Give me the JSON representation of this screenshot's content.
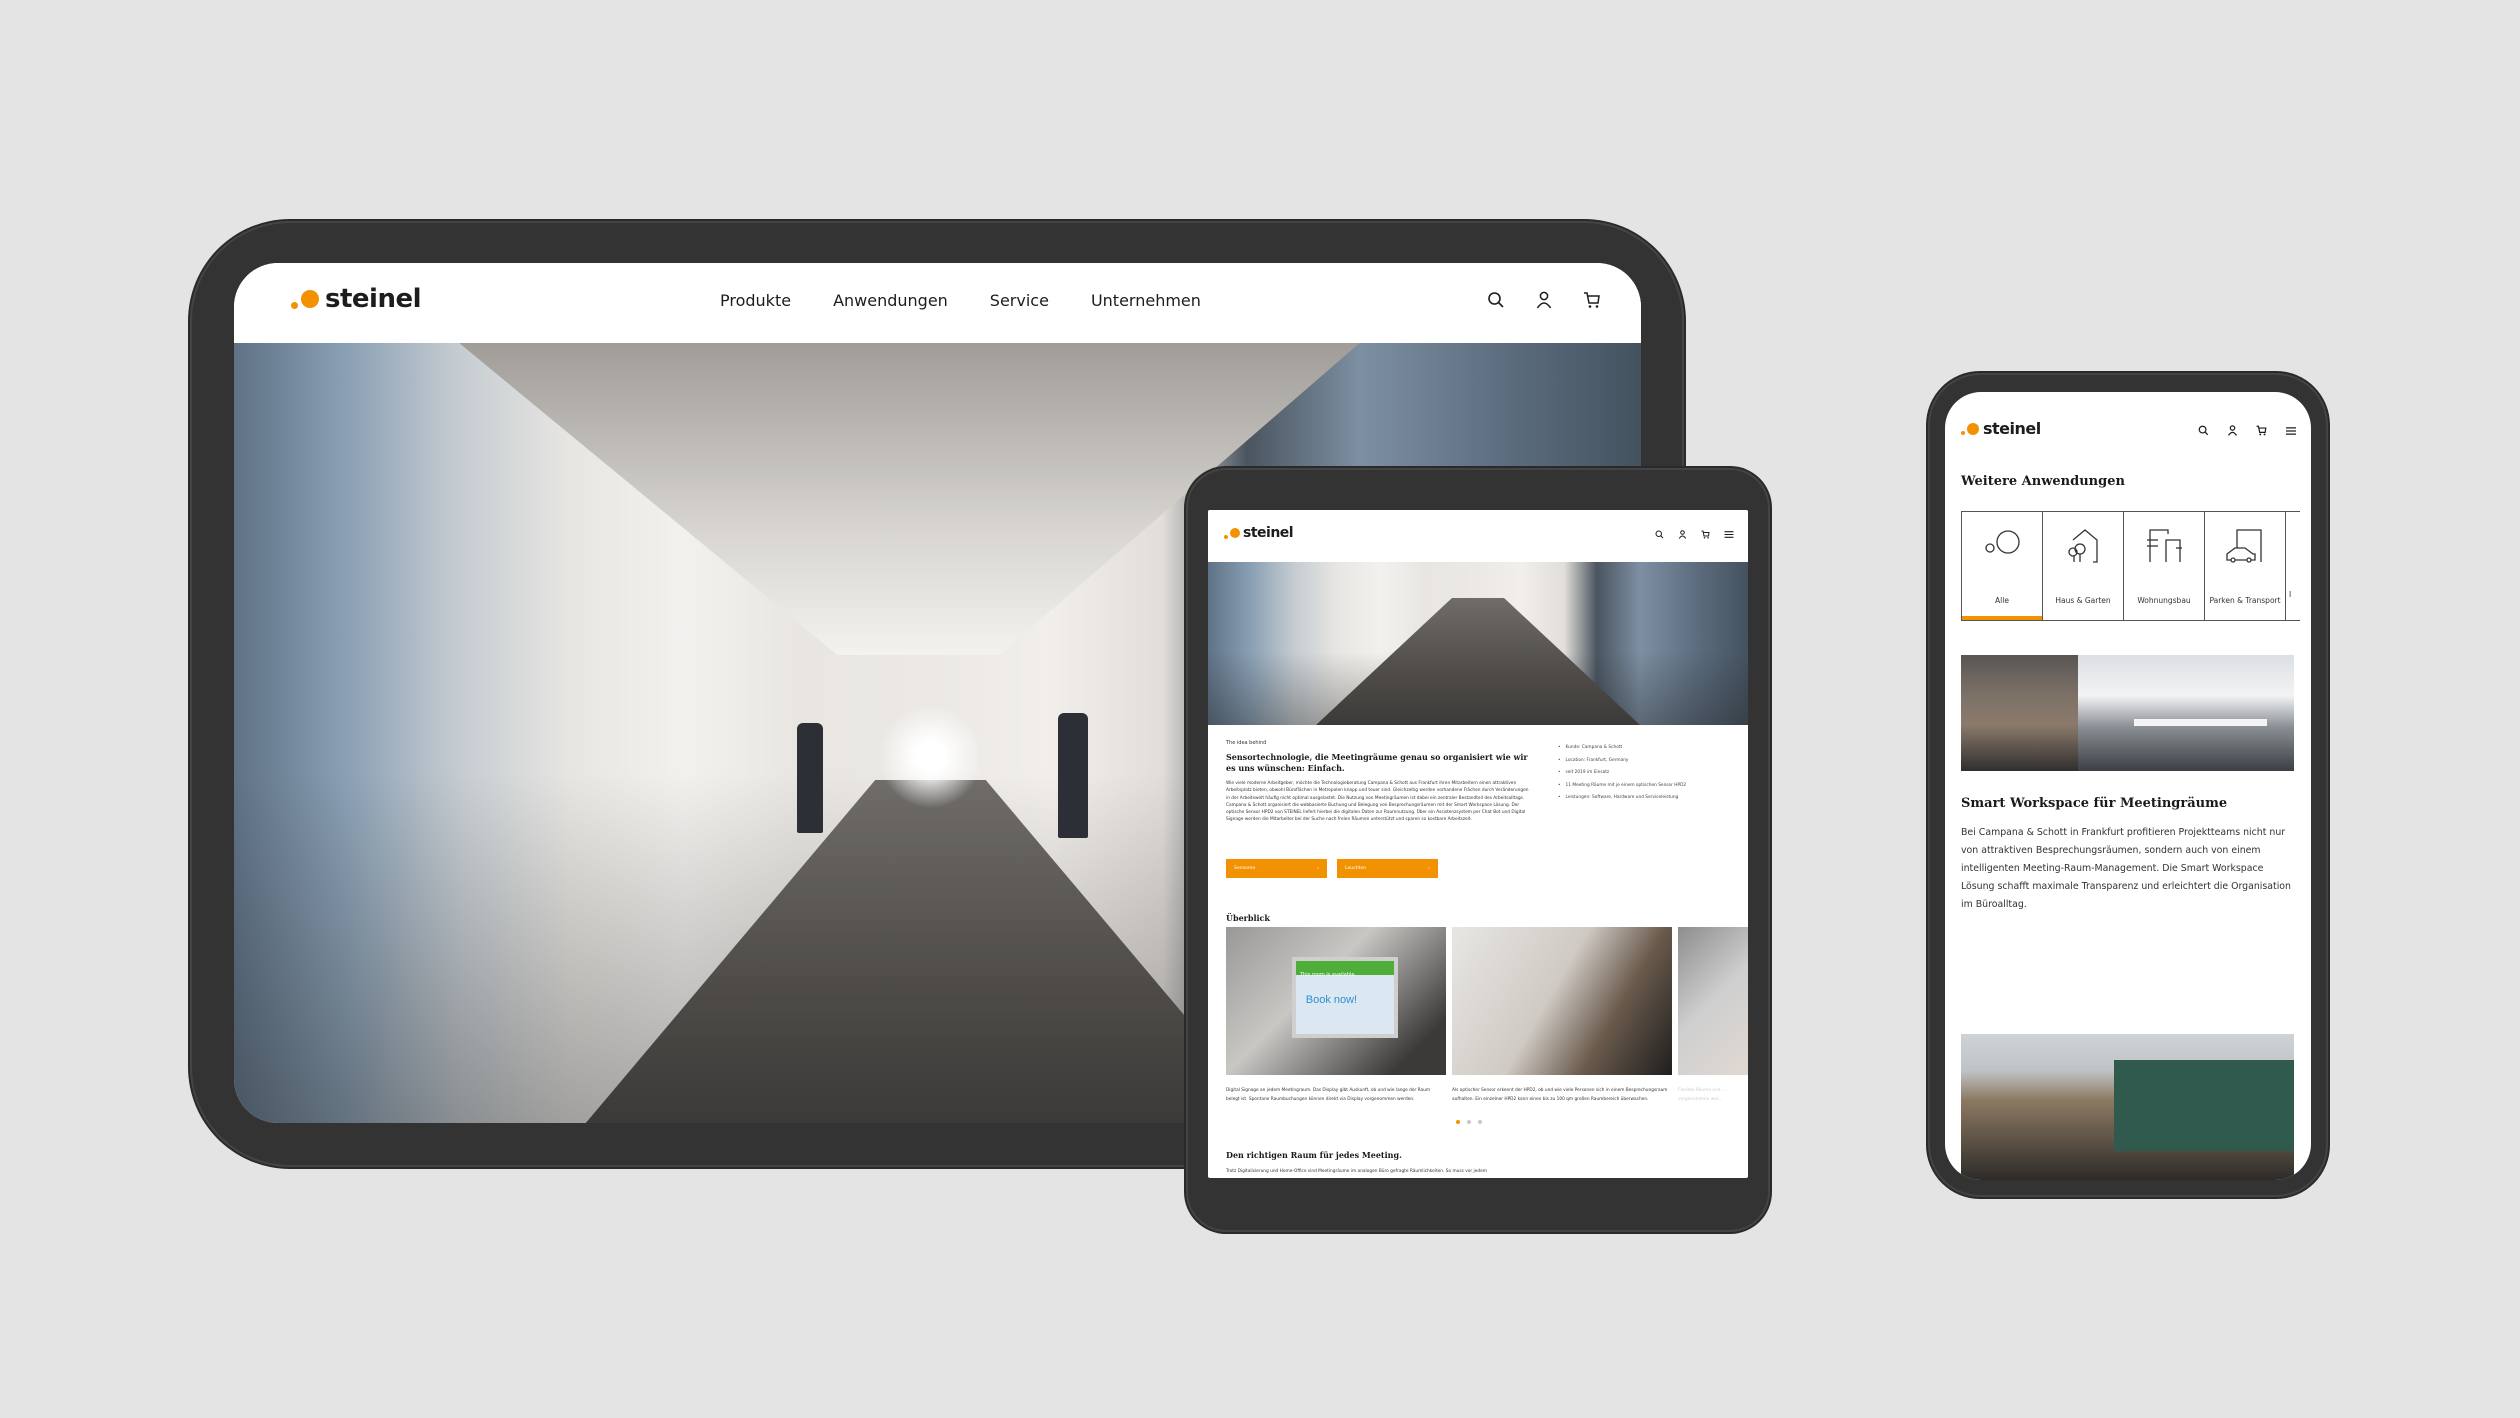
{
  "brand": {
    "name": "steinel",
    "accent_color": "#f39200",
    "frame_color": "#333333",
    "background_color": "#e4e4e4"
  },
  "tablet_large": {
    "nav": [
      "Produkte",
      "Anwendungen",
      "Service",
      "Unternehmen"
    ],
    "icons": [
      "search-icon",
      "user-icon",
      "cart-icon"
    ],
    "hero_image": "Office corridor with glass walls and two men using room-booking displays"
  },
  "tablet_small": {
    "icons": [
      "search-icon",
      "user-icon",
      "cart-icon",
      "menu-icon"
    ],
    "hero_image": "Office corridor with carpet floor",
    "eyebrow": "The idea behind",
    "title": "Sensortechnologie, die Meetingräume genau so organisiert wie wir es uns wünschen: Einfach.",
    "body": "Wie viele moderne Arbeitgeber, möchte die Technologieberatung Campana & Schott aus Frankfurt ihren Mitarbeitern einen attraktiven Arbeitsplatz bieten, obwohl Büroflächen in Metropolen knapp und teuer sind. Gleichzeitig werden vorhandene Flächen durch Veränderungen in der Arbeitswelt häufig nicht optimal ausgelastet. Die Nutzung von Meetingräumen ist dabei ein zentraler Bestandteil des Arbeitsalltags. Campana & Schott organisiert die webbasierte Buchung und Belegung von Besprechungsräumen mit der Smart Workspace Lösung. Der optische Sensor HPD2 von STEINEL liefert hierbei die digitalen Daten zur Raumnutzung. Über ein Assistenzsystem per Chat Bot und Digital Signage werden die Mitarbeiter bei der Suche nach freien Räumen unterstützt und sparen so kostbare Arbeitszeit.",
    "facts": [
      "Kunde: Campana & Schott",
      "Location: Frankfurt, Germany",
      "seit 2019 im Einsatz",
      "11 Meeting Räume mit je einem optischen Sensor HPD2",
      "Leistungen: Software, Hardware und Serviceleistung"
    ],
    "buttons": [
      {
        "label": "Sensoren",
        "arrow": "›"
      },
      {
        "label": "Leuchten",
        "arrow": "›"
      }
    ],
    "overview_title": "Überblick",
    "cards": [
      {
        "image": "Hand tapping Book now on room display",
        "screen_status": "This room is available.",
        "screen_cta": "Book now!",
        "caption": "Digital Signage an jedem Meetingraum. Das Display gibt Auskunft, ob und wie lange der Raum belegt ist. Spontane Raumbuchungen können direkt via Display vorgenommen werden."
      },
      {
        "image": "Man in meeting room with ceiling sensor HPD2",
        "caption": "Als optischer Sensor erkennt der HPD2, ob und wie viele Personen sich in einem Besprechungsraum aufhalten. Ein einzelner HPD2 kann einen bis zu 100 qm großen Raumbereich überwachen."
      },
      {
        "image": "Blurred meeting room",
        "caption": "Flexible Räume und ... vorgenommen wer..."
      }
    ],
    "carousel": {
      "total": 3,
      "active": 1
    },
    "section2_title": "Den richtigen Raum für jedes Meeting.",
    "section2_body": "Trotz Digitalisierung und Home-Office sind Meetingräume im analogen Büro gefragte Räumlichkeiten. So muss vor jedem"
  },
  "phone": {
    "icons": [
      "search-icon",
      "user-icon",
      "cart-icon",
      "menu-icon"
    ],
    "section_title": "Weitere Anwendungen",
    "categories": [
      {
        "label": "Alle",
        "icon": "circles-icon",
        "active": true
      },
      {
        "label": "Haus & Garten",
        "icon": "house-tree-icon",
        "active": false
      },
      {
        "label": "Wohnungsbau",
        "icon": "buildings-icon",
        "active": false
      },
      {
        "label": "Parken & Transport",
        "icon": "car-garage-icon",
        "active": false
      },
      {
        "label": "I",
        "icon": "partial-icon",
        "active": false
      }
    ],
    "card1_image": "Open-plan office with glass meeting box",
    "card1_title": "Smart Workspace für Meetingräume",
    "card1_body": "Bei Campana & Schott in Frankfurt profitieren Projektteams nicht nur von attraktiven Besprechungsräumen, sondern auch von einem intelligenten Meeting-Raum-Management. Die Smart Workspace Lösung schafft maximale Transparenz und erleichtert die Organisation im Büroalltag.",
    "card2_image": "Classroom with students and teacher at green chalkboard"
  }
}
